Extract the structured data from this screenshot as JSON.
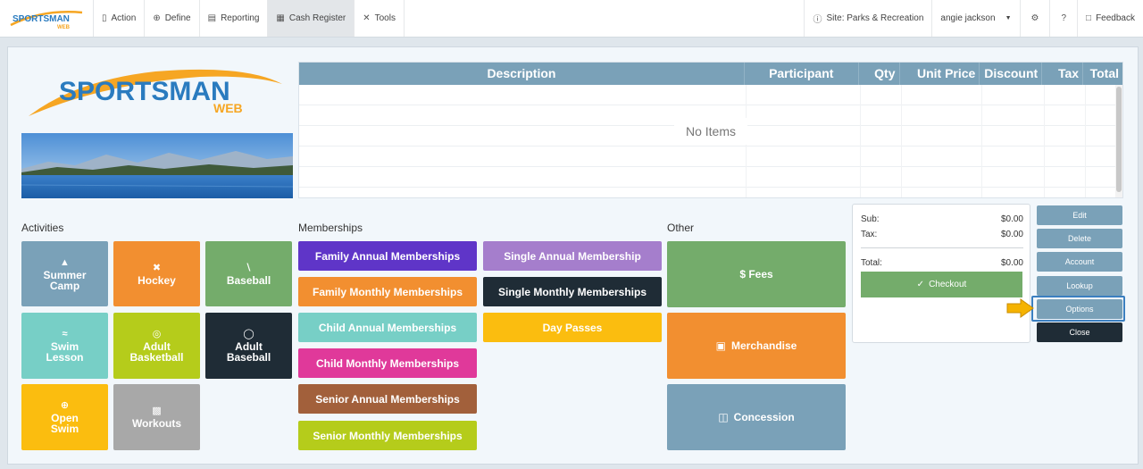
{
  "brand": {
    "name": "SPORTSMAN",
    "sub": "WEB"
  },
  "nav": {
    "items": [
      {
        "label": "Action",
        "icon": "flashlight-icon"
      },
      {
        "label": "Define",
        "icon": "plus-circle-icon"
      },
      {
        "label": "Reporting",
        "icon": "document-icon"
      },
      {
        "label": "Cash Register",
        "icon": "register-icon"
      },
      {
        "label": "Tools",
        "icon": "tools-icon"
      }
    ],
    "site": "Site: Parks & Recreation",
    "user": "angie jackson",
    "feedback": "Feedback"
  },
  "table": {
    "headers": [
      "Description",
      "Participant",
      "Qty",
      "Unit Price",
      "Discount",
      "Tax",
      "Total"
    ],
    "empty": "No Items"
  },
  "sections": {
    "activities": "Activities",
    "memberships": "Memberships",
    "other": "Other"
  },
  "activities": [
    {
      "line1": "Summer",
      "line2": "Camp",
      "icon": "tent-icon",
      "color": "#7aa1b8"
    },
    {
      "line1": "Hockey",
      "line2": "",
      "icon": "hockey-icon",
      "color": "#f28f30"
    },
    {
      "line1": "Baseball",
      "line2": "",
      "icon": "baseball-bat-icon",
      "color": "#74ac6b"
    },
    {
      "line1": "Swim",
      "line2": "Lesson",
      "icon": "swim-icon",
      "color": "#77cfc6"
    },
    {
      "line1": "Adult",
      "line2": "Basketball",
      "icon": "basketball-icon",
      "color": "#b5cc1b"
    },
    {
      "line1": "Adult",
      "line2": "Baseball",
      "icon": "baseball-icon",
      "color": "#1f2c36"
    },
    {
      "line1": "Open",
      "line2": "Swim",
      "icon": "ball-icon",
      "color": "#fbbd0f"
    },
    {
      "line1": "Workouts",
      "line2": "",
      "icon": "dumbbell-icon",
      "color": "#a8a8a8"
    }
  ],
  "memberships": [
    {
      "label": "Family Annual Memberships",
      "color": "#5f35c8"
    },
    {
      "label": "Single Annual Membership",
      "color": "#a57ecc"
    },
    {
      "label": "Family Monthly Memberships",
      "color": "#f28f30"
    },
    {
      "label": "Single Monthly Memberships",
      "color": "#1f2c36"
    },
    {
      "label": "Child Annual Memberships",
      "color": "#77cfc6"
    },
    {
      "label": "Day Passes",
      "color": "#fbbd0f"
    },
    {
      "label": "Child Monthly Memberships",
      "color": "#e0399a"
    },
    {
      "label": "Senior Annual Memberships",
      "color": "#a2603b"
    },
    {
      "label": "Senior Monthly Memberships",
      "color": "#b5cc1b"
    }
  ],
  "other": [
    {
      "label": "$ Fees",
      "color": "#74ac6b",
      "icon": ""
    },
    {
      "label": "Merchandise",
      "color": "#f28f30",
      "icon": "bag-icon"
    },
    {
      "label": "Concession",
      "color": "#7aa1b8",
      "icon": "cup-icon"
    }
  ],
  "totals": {
    "sub_label": "Sub:",
    "sub_value": "$0.00",
    "tax_label": "Tax:",
    "tax_value": "$0.00",
    "total_label": "Total:",
    "total_value": "$0.00",
    "checkout": "Checkout"
  },
  "side_buttons": [
    "Edit",
    "Delete",
    "Account",
    "Lookup",
    "Options",
    "Close"
  ]
}
